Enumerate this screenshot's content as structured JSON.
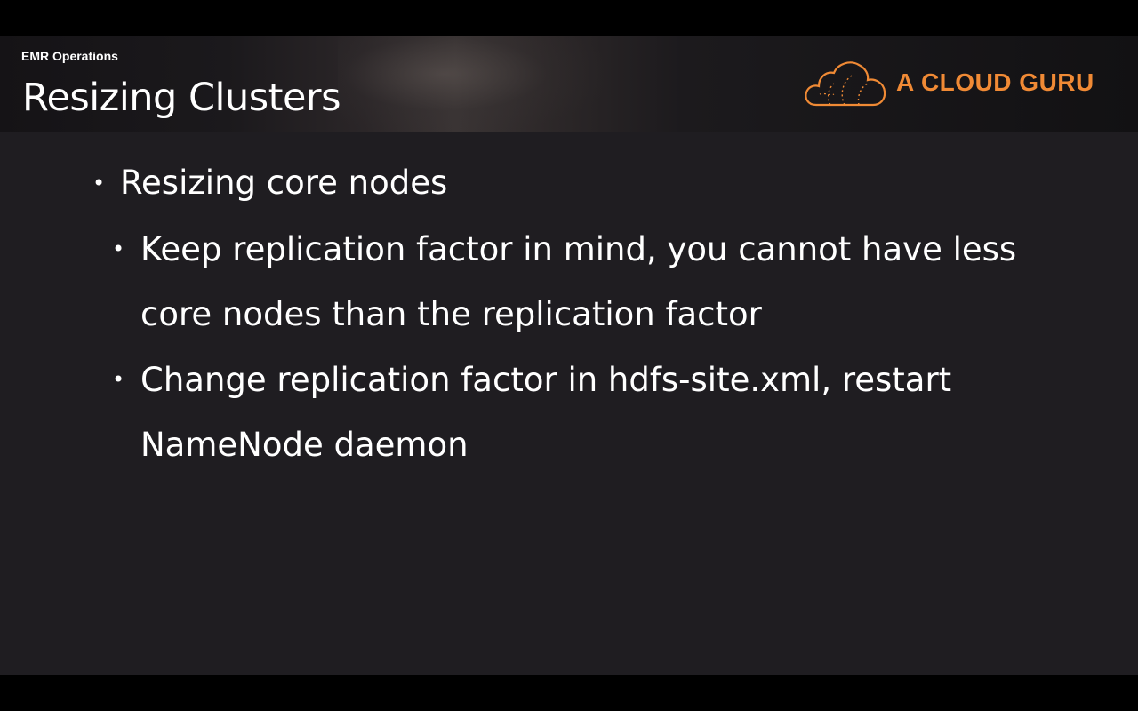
{
  "header": {
    "section_label": "EMR Operations",
    "title": "Resizing Clusters",
    "logo_text": "A CLOUD GURU",
    "logo_color": "#f08a35",
    "logo_icon": "cloud-icon"
  },
  "content": {
    "bullets": [
      {
        "text": "Resizing core nodes",
        "sub_bullets": [
          {
            "text": "Keep replication factor in mind, you cannot have less core nodes than the replication factor"
          },
          {
            "text": "Change replication factor in hdfs-site.xml, restart NameNode daemon"
          }
        ]
      }
    ],
    "bullet_glyph": "•"
  },
  "colors": {
    "background": "#1f1d21",
    "text": "#ffffff",
    "accent": "#f08a35"
  }
}
